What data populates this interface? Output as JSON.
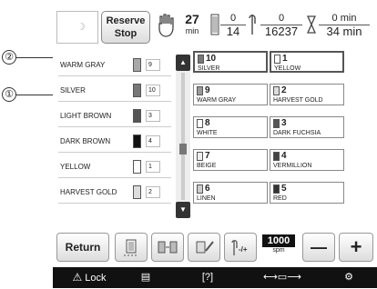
{
  "header": {
    "reserve_label": "Reserve Stop",
    "time_value": "27",
    "time_unit": "min",
    "stitch_fraction_top": "0",
    "stitch_fraction_bottom": "14",
    "total_top": "0",
    "total_bottom": "16237",
    "min_top": "0 min",
    "min_bottom": "34 min"
  },
  "callouts": [
    "②",
    "①"
  ],
  "order_list": [
    {
      "name": "WARM GRAY",
      "num": "9",
      "color": "#a8a8a8"
    },
    {
      "name": "SILVER",
      "num": "10",
      "color": "#777"
    },
    {
      "name": "LIGHT BROWN",
      "num": "3",
      "color": "#555"
    },
    {
      "name": "DARK BROWN",
      "num": "4",
      "color": "#111"
    },
    {
      "name": "YELLOW",
      "num": "1",
      "color": "#fff"
    },
    {
      "name": "HARVEST GOLD",
      "num": "2",
      "color": "#ddd"
    }
  ],
  "thread_grid": [
    {
      "n": "10",
      "name": "SILVER",
      "color": "#777"
    },
    {
      "n": "1",
      "name": "YELLOW",
      "color": "#fff"
    },
    {
      "n": "9",
      "name": "WARM GRAY",
      "color": "#999"
    },
    {
      "n": "2",
      "name": "HARVEST GOLD",
      "color": "#ddd"
    },
    {
      "n": "8",
      "name": "WHITE",
      "color": "#fff"
    },
    {
      "n": "3",
      "name": "DARK FUCHSIA",
      "color": "#555"
    },
    {
      "n": "7",
      "name": "BEIGE",
      "color": "#eee"
    },
    {
      "n": "4",
      "name": "VERMILLION",
      "color": "#444"
    },
    {
      "n": "6",
      "name": "LINEN",
      "color": "#ccc"
    },
    {
      "n": "5",
      "name": "RED",
      "color": "#333"
    }
  ],
  "buttons": {
    "return": "Return",
    "speed": "1000",
    "speed_unit": "spm",
    "minus": "—",
    "plus": "+"
  },
  "bottom": {
    "lock": "Lock"
  }
}
